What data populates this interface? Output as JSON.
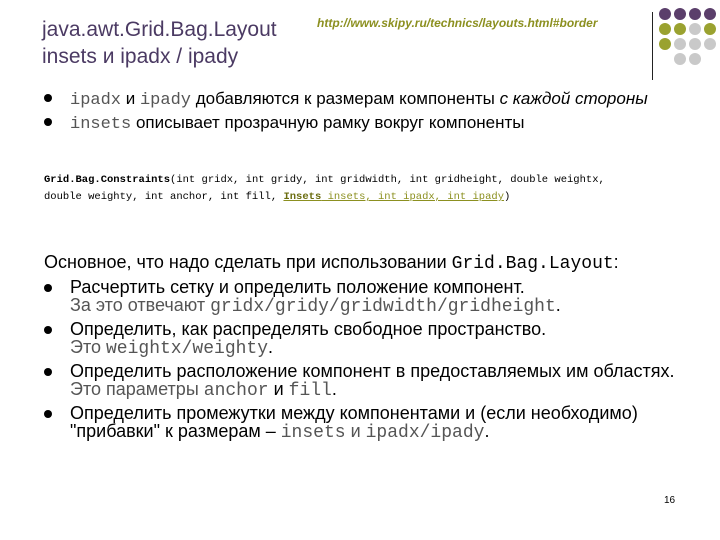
{
  "title": {
    "line1": "java.awt.Grid.Bag.Layout",
    "line2": "insets и ipadx / ipady"
  },
  "url": "http://www.skipy.ru/technics/layouts.html#border",
  "decor": {
    "dot_colors": [
      "#5b3f6b",
      "#5b3f6b",
      "#5b3f6b",
      "#5b3f6b",
      "#9aa230",
      "#9aa230",
      "#c9c9c9",
      "#9aa230",
      "#9aa230",
      "#c9c9c9",
      "#c9c9c9",
      "#c9c9c9",
      "#c9c9c9",
      "#c9c9c9"
    ]
  },
  "bullets": [
    {
      "code1": "ipadx",
      "text1": " и ",
      "code2": "ipady",
      "text2": " добавляются к размерам  компоненты ",
      "italic": "с каждой стороны"
    },
    {
      "code1": "insets",
      "text1": " описывает прозрачную рамку вокруг компоненты"
    }
  ],
  "signature": {
    "name": "Grid.Bag.Constraints",
    "args1": "(int gridx, int gridy, int gridwidth, int gridheight, double weightx,",
    "args2": "double weighty, int anchor, int fill, ",
    "hl_type": "Insets",
    "hl_rest": " insets, int ipadx, int ipady",
    "end": ")"
  },
  "main": {
    "intro_text": "Основное, что надо сделать при использовании ",
    "intro_code": "Grid.Bag.Layout",
    "intro_end": ":",
    "items": [
      {
        "text": "Расчертить сетку и определить положение компонент.",
        "note_text": "За это отвечают ",
        "note_code": "gridx/gridy/gridwidth/gridheight",
        "note_end": "."
      },
      {
        "text": "Определить, как распределять свободное пространство.",
        "note_text": "Это ",
        "note_code": "weightx/weighty",
        "note_end": "."
      },
      {
        "text": "Определить расположение компонент в предоставляемых им областях.",
        "note_text": " Это параметры ",
        "note_code": "anchor",
        "note_mid": " и ",
        "note_code2": "fill",
        "note_end": "."
      },
      {
        "text": "Определить промежутки между компонентами и (если необходимо) \"прибавки\" к размерам – ",
        "code": "insets",
        "mid": " и ",
        "code2": "ipadx/ipady",
        "end": "."
      }
    ]
  },
  "page_number": "16"
}
